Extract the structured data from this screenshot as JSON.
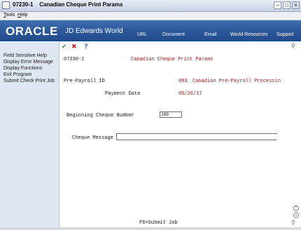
{
  "window": {
    "title": "07230-1    Canadian Cheque Print Params",
    "controls": [
      "minimize-icon",
      "maximize-icon",
      "close-icon"
    ]
  },
  "menubar": {
    "items": [
      "Tools",
      "Help"
    ]
  },
  "banner": {
    "brand": "ORACLE",
    "product": "JD Edwards World",
    "links": [
      "URL",
      "Document",
      "Email",
      "World Resources",
      "Support"
    ]
  },
  "sidebar": {
    "items": [
      "Field Sensitive Help",
      "Display Error Message",
      "Display Functions",
      "Exit Program",
      "Submit Check Print Job"
    ]
  },
  "toolbar": {
    "icons": [
      "check-icon",
      "cancel-icon",
      "help-icon"
    ]
  },
  "form": {
    "program_id": "07230-1",
    "title": "Canadian Cheque Print Params",
    "pre_payroll_label": "Pre-Payroll ID",
    "pre_payroll_code": "003",
    "pre_payroll_desc": "Canadian Pre-Payroll Processin",
    "payment_date_label": "Payment Date",
    "payment_date_value": "05/26/17",
    "beginning_cheque_label": "Beginning Cheque Number",
    "beginning_cheque_value": "100",
    "cheque_message_label": "Cheque Message",
    "cheque_message_value": "",
    "function_key": "F6=Submit Job"
  },
  "colors": {
    "banner": "#2c5798",
    "sidebar": "#dfe7f2",
    "value_red": "#9e1b1b"
  }
}
